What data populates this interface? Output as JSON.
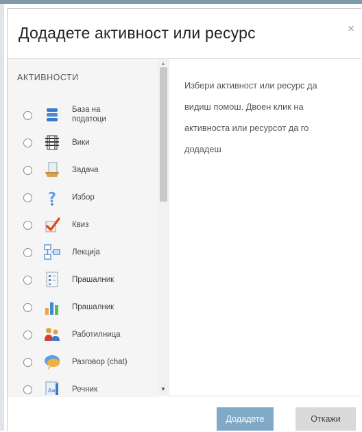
{
  "dialog": {
    "title": "Додадете активност или ресурс",
    "close_label": "×"
  },
  "activities": {
    "section_title": "АКТИВНОСТИ",
    "items": [
      {
        "label": "База на\nподатоци",
        "icon": "database-icon"
      },
      {
        "label": "Вики",
        "icon": "wiki-icon"
      },
      {
        "label": "Задача",
        "icon": "assignment-icon"
      },
      {
        "label": "Избор",
        "icon": "choice-icon"
      },
      {
        "label": "Квиз",
        "icon": "quiz-icon"
      },
      {
        "label": "Лекција",
        "icon": "lesson-icon"
      },
      {
        "label": "Прашалник",
        "icon": "feedback-icon"
      },
      {
        "label": "Прашалник",
        "icon": "survey-icon"
      },
      {
        "label": "Работилница",
        "icon": "workshop-icon"
      },
      {
        "label": "Разговор (chat)",
        "icon": "chat-icon"
      },
      {
        "label": "Речник",
        "icon": "glossary-icon"
      }
    ]
  },
  "help_text": "Избери активност или ресурс да видиш помош. Двоен клик на активноста или ресурсот да го додадеш",
  "footer": {
    "add_label": "Додадете",
    "cancel_label": "Откажи"
  },
  "colors": {
    "primary_button": "#7fa9c6",
    "secondary_button": "#d9d9d9",
    "list_background": "#f5f5f5"
  }
}
